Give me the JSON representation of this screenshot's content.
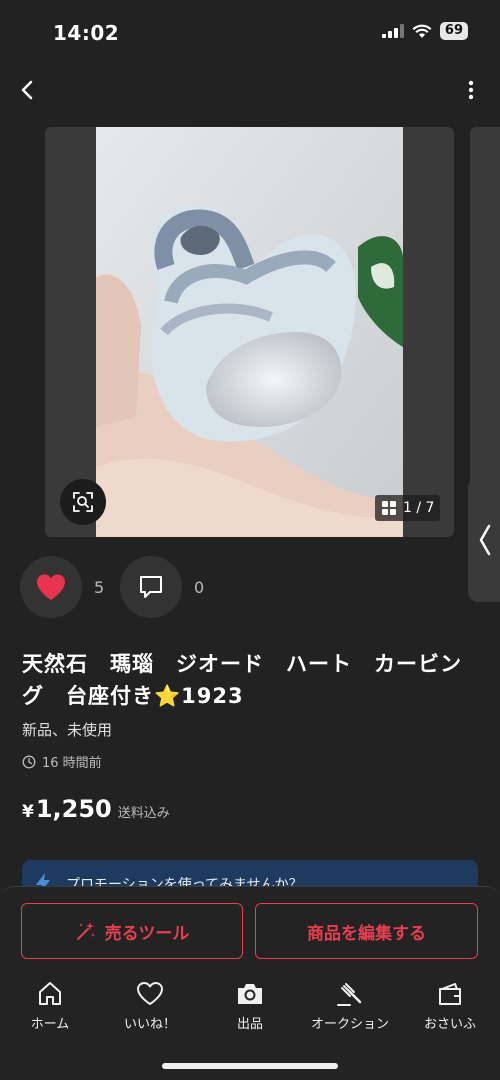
{
  "status_bar": {
    "time": "14:02",
    "battery": "69"
  },
  "carousel": {
    "counter": "1 / 7"
  },
  "engagement": {
    "likes": "5",
    "comments": "0"
  },
  "item": {
    "title": "天然石　瑪瑙　ジオード　ハート　カービング　台座付き⭐1923",
    "condition": "新品、未使用",
    "posted": "16 時間前",
    "currency": "¥",
    "price": "1,250",
    "shipping": "送料込み"
  },
  "promo": {
    "text": "プロモーションを使ってみませんか？"
  },
  "buttons": {
    "sell_tools": "売るツール",
    "edit_item": "商品を編集する"
  },
  "tabs": [
    {
      "label": "ホーム",
      "icon": "home-icon"
    },
    {
      "label": "いいね！",
      "icon": "heart-outline-icon"
    },
    {
      "label": "出品",
      "icon": "camera-icon"
    },
    {
      "label": "オークション",
      "icon": "gavel-icon"
    },
    {
      "label": "おさいふ",
      "icon": "wallet-icon"
    }
  ],
  "colors": {
    "accent": "#ea3d4e",
    "like": "#e8344e",
    "background": "#222222",
    "promo": "#1e3a5f"
  }
}
